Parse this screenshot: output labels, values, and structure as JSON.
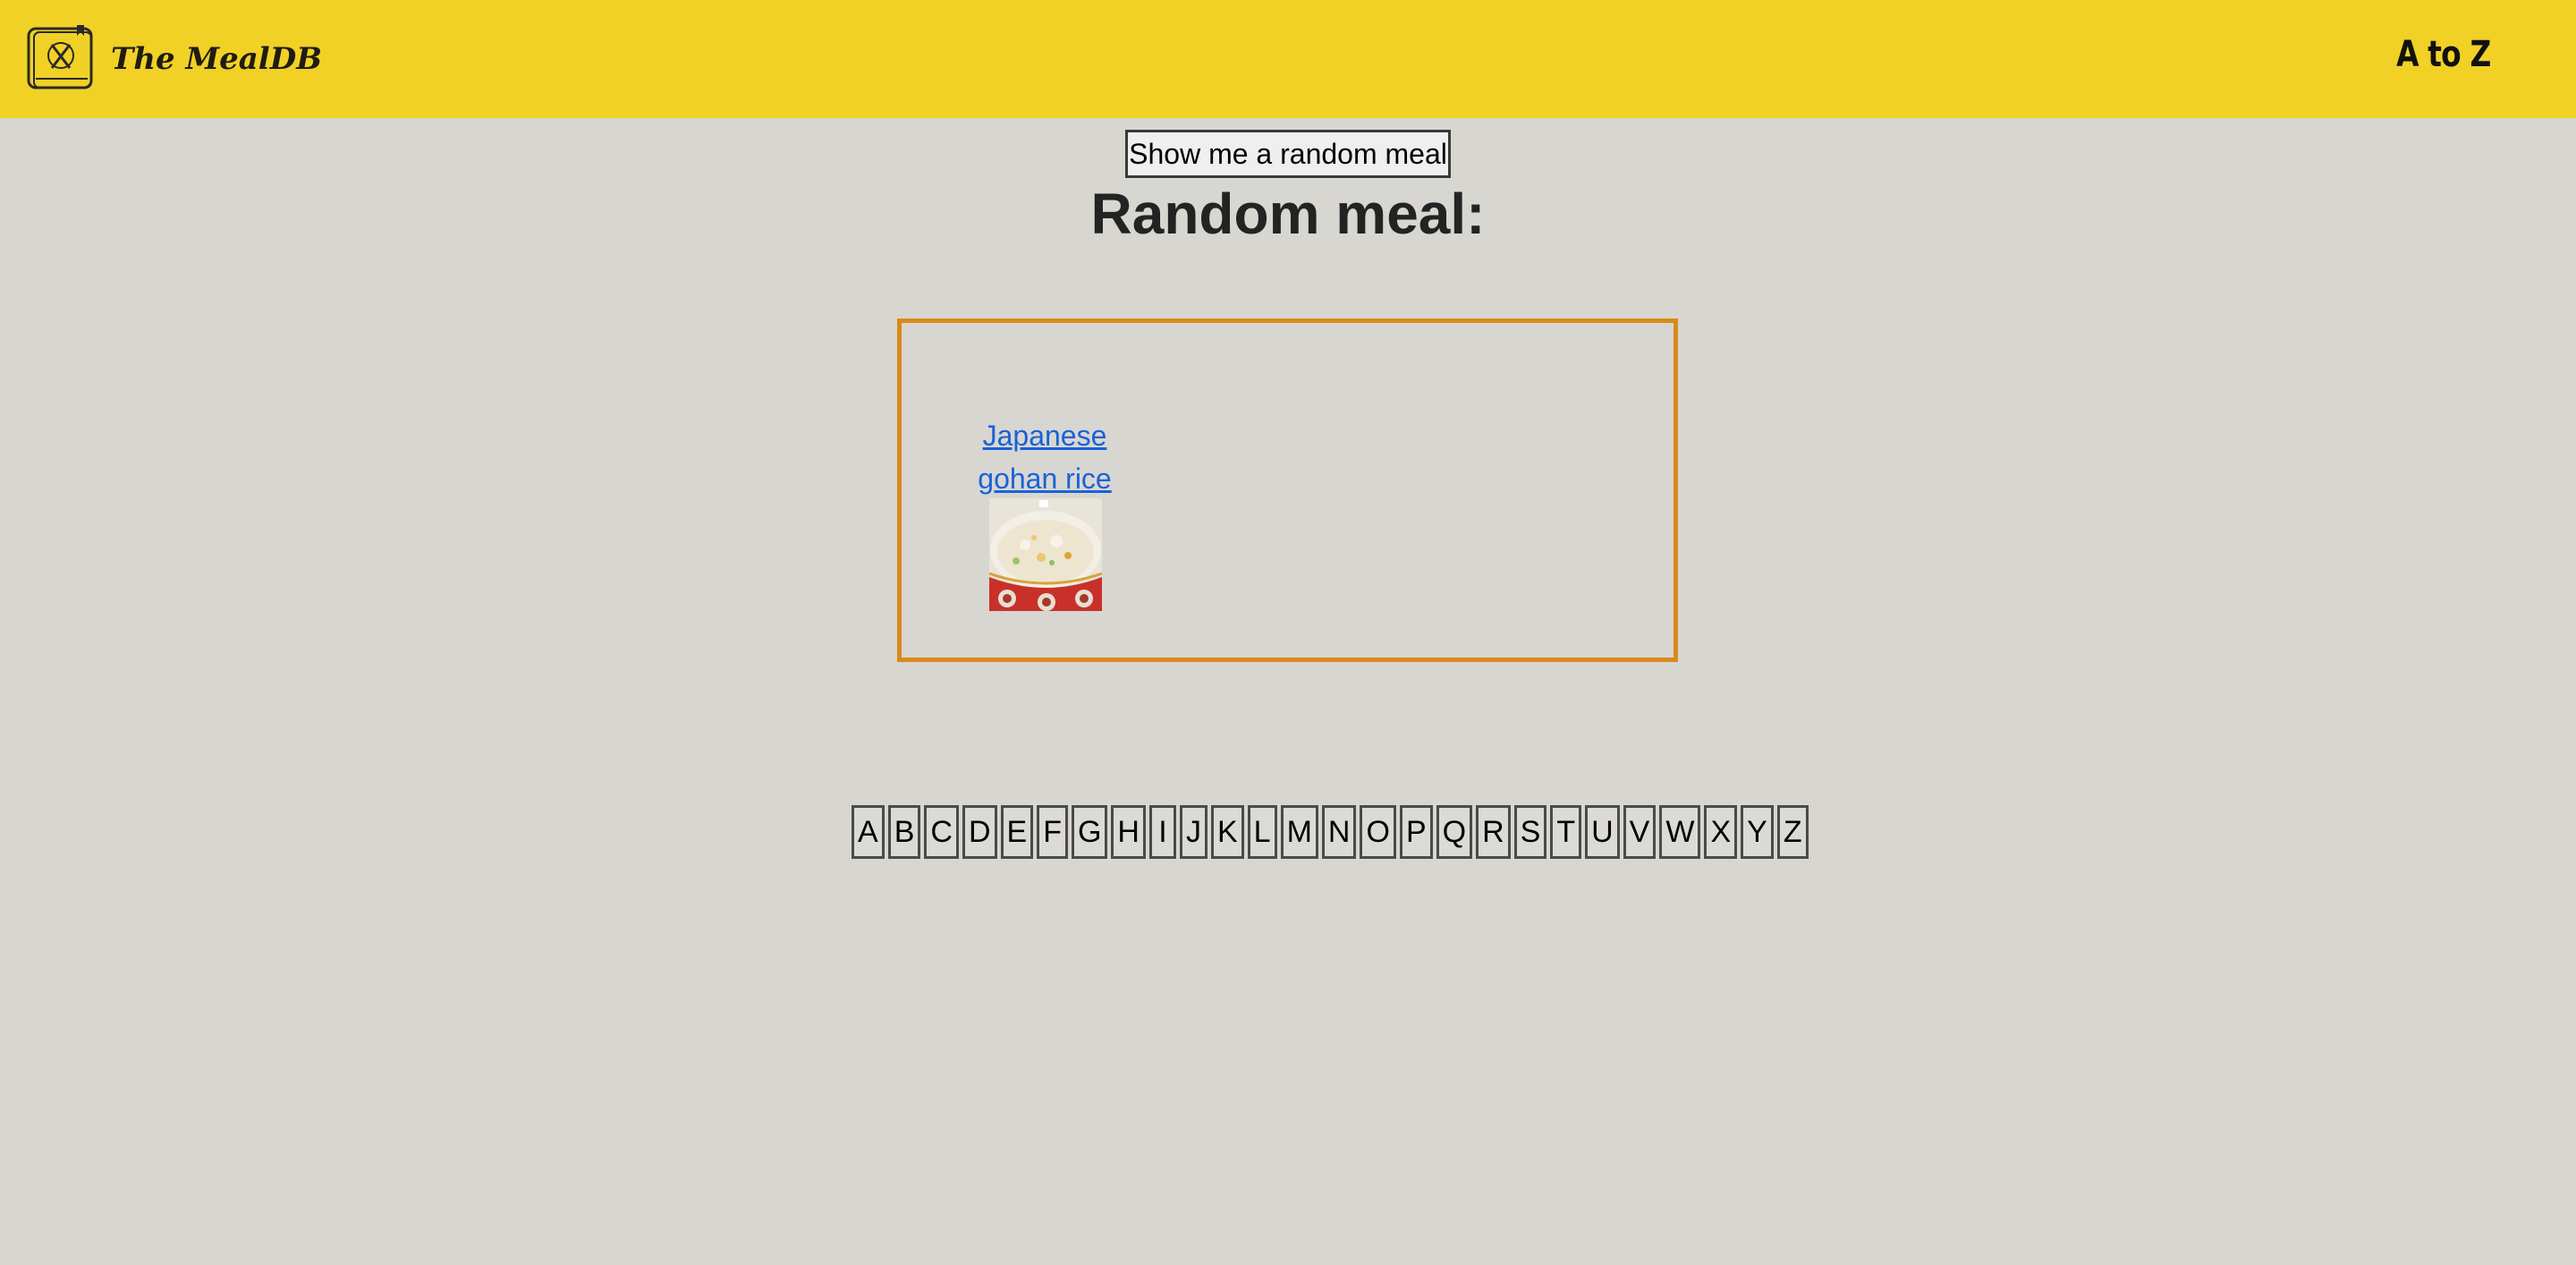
{
  "header": {
    "brand": "The MealDB",
    "nav_link": "A to Z"
  },
  "actions": {
    "random_button": "Show me a random meal"
  },
  "main": {
    "title": "Random meal:",
    "meal": {
      "name": "Japanese gohan rice"
    }
  },
  "alphabet": [
    "A",
    "B",
    "C",
    "D",
    "E",
    "F",
    "G",
    "H",
    "I",
    "J",
    "K",
    "L",
    "M",
    "N",
    "O",
    "P",
    "Q",
    "R",
    "S",
    "T",
    "U",
    "V",
    "W",
    "X",
    "Y",
    "Z"
  ],
  "colors": {
    "header_bg": "#f1d125",
    "page_bg": "#d8d6d1",
    "card_border": "#d98a1a",
    "link": "#1a62d8"
  },
  "icons": {
    "logo": "mealdb-logo-icon"
  }
}
